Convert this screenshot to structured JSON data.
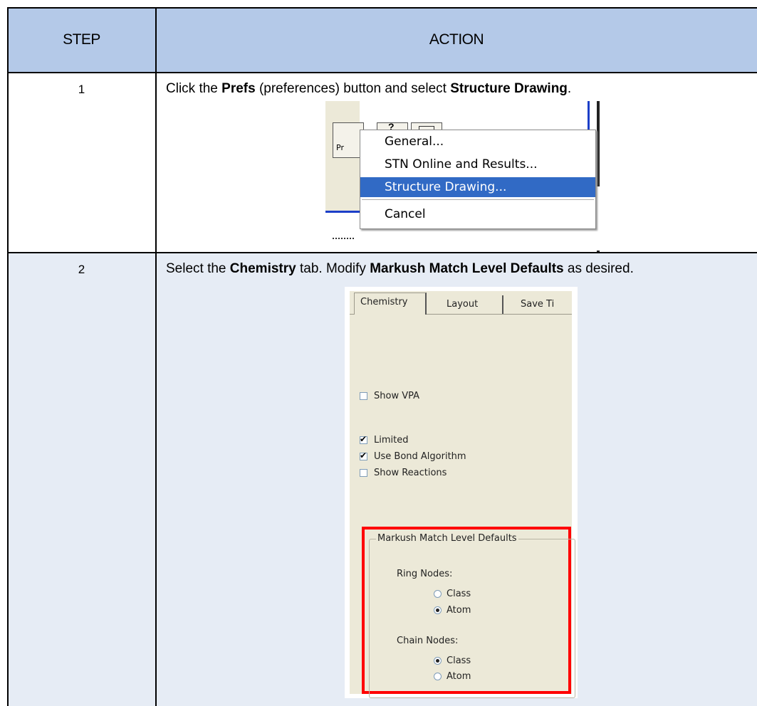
{
  "table": {
    "header": {
      "step": "STEP",
      "action": "ACTION"
    },
    "rows": [
      {
        "step": "1",
        "action_parts": [
          "Click the ",
          "Prefs",
          " (preferences) button and select ",
          "Structure Drawing",
          "."
        ]
      },
      {
        "step": "2",
        "action_parts": [
          "Select the ",
          "Chemistry",
          " tab. Modify ",
          "Markush Match Level Defaults",
          " as desired."
        ]
      }
    ]
  },
  "prefs_menu": {
    "items": [
      "General...",
      "STN Online and Results...",
      "Structure Drawing...",
      "Cancel"
    ],
    "selected": "Structure Drawing...",
    "toolbar_partial_label": "Pr"
  },
  "dialog": {
    "tabs": [
      "Chemistry",
      "Layout",
      "Save Ti"
    ],
    "active_tab": "Chemistry",
    "checkboxes": [
      {
        "label": "Show VPA",
        "checked": false
      },
      {
        "label": "Limited",
        "checked": true
      },
      {
        "label": "Use Bond Algorithm",
        "checked": true
      },
      {
        "label": "Show Reactions",
        "checked": false
      }
    ],
    "markush": {
      "title": "Markush Match Level Defaults",
      "ring_label": "Ring Nodes:",
      "ring_options": [
        {
          "label": "Class",
          "selected": false
        },
        {
          "label": "Atom",
          "selected": true
        }
      ],
      "chain_label": "Chain Nodes:",
      "chain_options": [
        {
          "label": "Class",
          "selected": true
        },
        {
          "label": "Atom",
          "selected": false
        }
      ]
    }
  },
  "colors": {
    "header_bg": "#b4c9e8",
    "row2_bg": "#e6ecf5",
    "highlight": "#ff0000",
    "menu_selected": "#316ac5"
  }
}
